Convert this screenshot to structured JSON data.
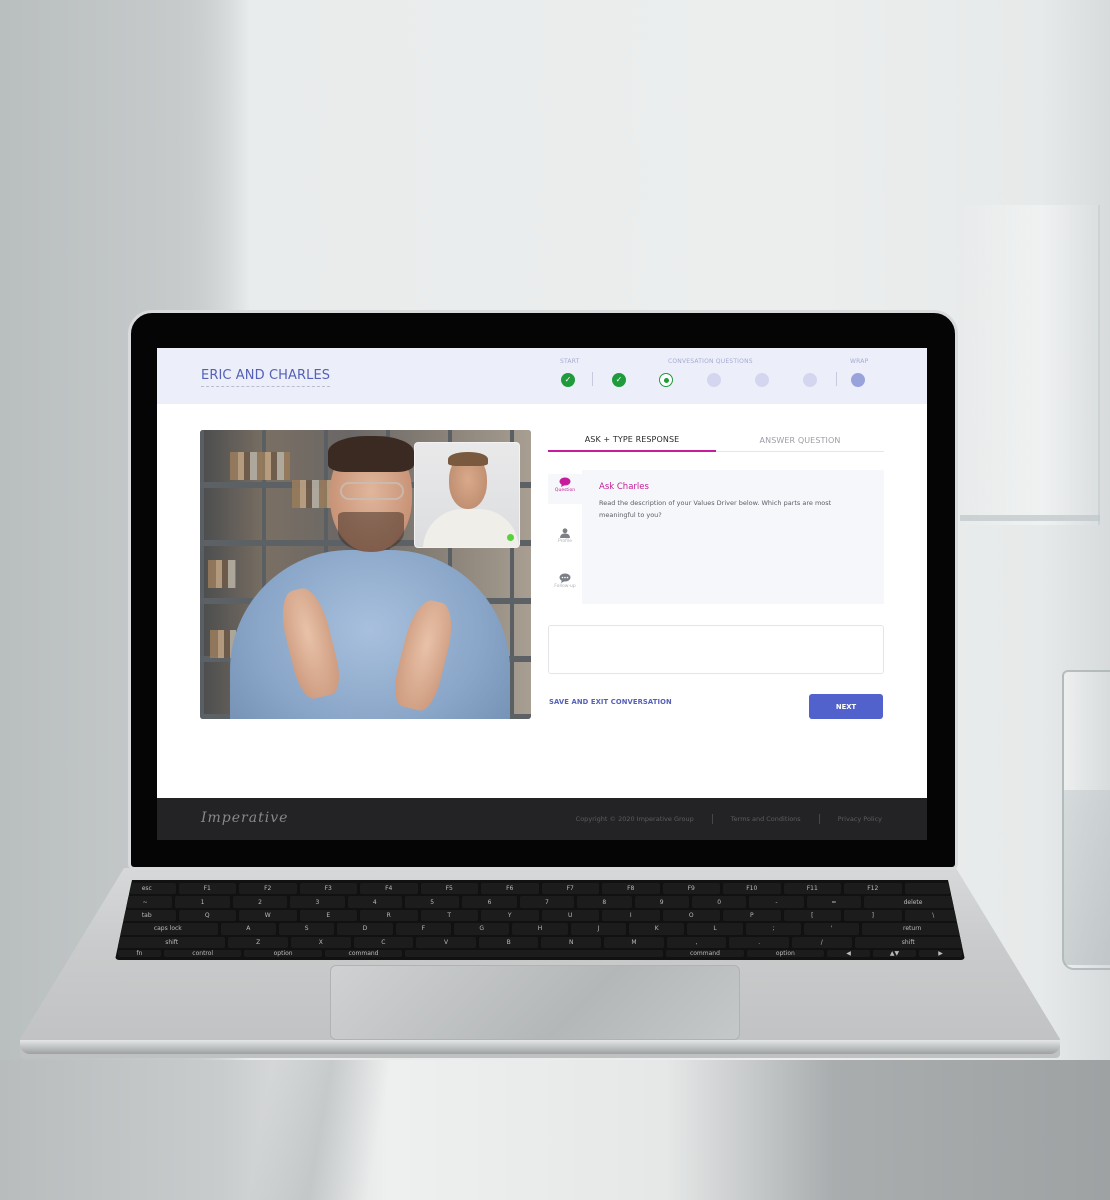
{
  "header": {
    "title": "ERIC AND CHARLES"
  },
  "stepper": {
    "labels": {
      "start": "START",
      "questions": "CONVESATION QUESTIONS",
      "wrap": "WRAP"
    },
    "steps": [
      {
        "state": "done"
      },
      {
        "state": "done"
      },
      {
        "state": "current"
      },
      {
        "state": "pending"
      },
      {
        "state": "pending"
      },
      {
        "state": "pending"
      },
      {
        "state": "wrap"
      }
    ]
  },
  "video": {
    "main_participant": "video-main",
    "pip_status": "online"
  },
  "tabs": [
    {
      "label": "ASK + TYPE RESPONSE",
      "active": true
    },
    {
      "label": "ANSWER QUESTION",
      "active": false
    }
  ],
  "side_nav": [
    {
      "label": "Question",
      "icon": "chat-bubble-icon",
      "active": true
    },
    {
      "label": "Profile",
      "icon": "user-icon",
      "active": false
    },
    {
      "label": "Follow-up",
      "icon": "chat-dots-icon",
      "active": false
    }
  ],
  "question": {
    "title": "Ask Charles",
    "text": "Read the description of your Values Driver below. Which parts are most meaningful to you?"
  },
  "response": {
    "value": "",
    "placeholder": ""
  },
  "actions": {
    "save_exit": "SAVE AND EXIT CONVERSATION",
    "next": "NEXT"
  },
  "footer": {
    "logo": "Imperative",
    "copyright": "Copyright © 2020 Imperative Group",
    "terms": "Terms and Conditions",
    "privacy": "Privacy Policy"
  },
  "keyboard": {
    "rows": [
      [
        "esc",
        "F1",
        "F2",
        "F3",
        "F4",
        "F5",
        "F6",
        "F7",
        "F8",
        "F9",
        "F10",
        "F11",
        "F12",
        ""
      ],
      [
        "~",
        "1",
        "2",
        "3",
        "4",
        "5",
        "6",
        "7",
        "8",
        "9",
        "0",
        "-",
        "=",
        "delete"
      ],
      [
        "tab",
        "Q",
        "W",
        "E",
        "R",
        "T",
        "Y",
        "U",
        "I",
        "O",
        "P",
        "[",
        "]",
        "\\"
      ],
      [
        "caps lock",
        "A",
        "S",
        "D",
        "F",
        "G",
        "H",
        "J",
        "K",
        "L",
        ";",
        "'",
        "return"
      ],
      [
        "shift",
        "Z",
        "X",
        "C",
        "V",
        "B",
        "N",
        "M",
        ",",
        ".",
        "/",
        "shift"
      ],
      [
        "fn",
        "control",
        "option",
        "command",
        "",
        "command",
        "option",
        "◀",
        "▲▼",
        "▶"
      ]
    ]
  },
  "colors": {
    "accent_primary": "#5262cc",
    "accent_pink": "#c51c9b",
    "success_green": "#1f9b3c",
    "header_bg": "#eceff9",
    "footer_bg": "#232225"
  }
}
